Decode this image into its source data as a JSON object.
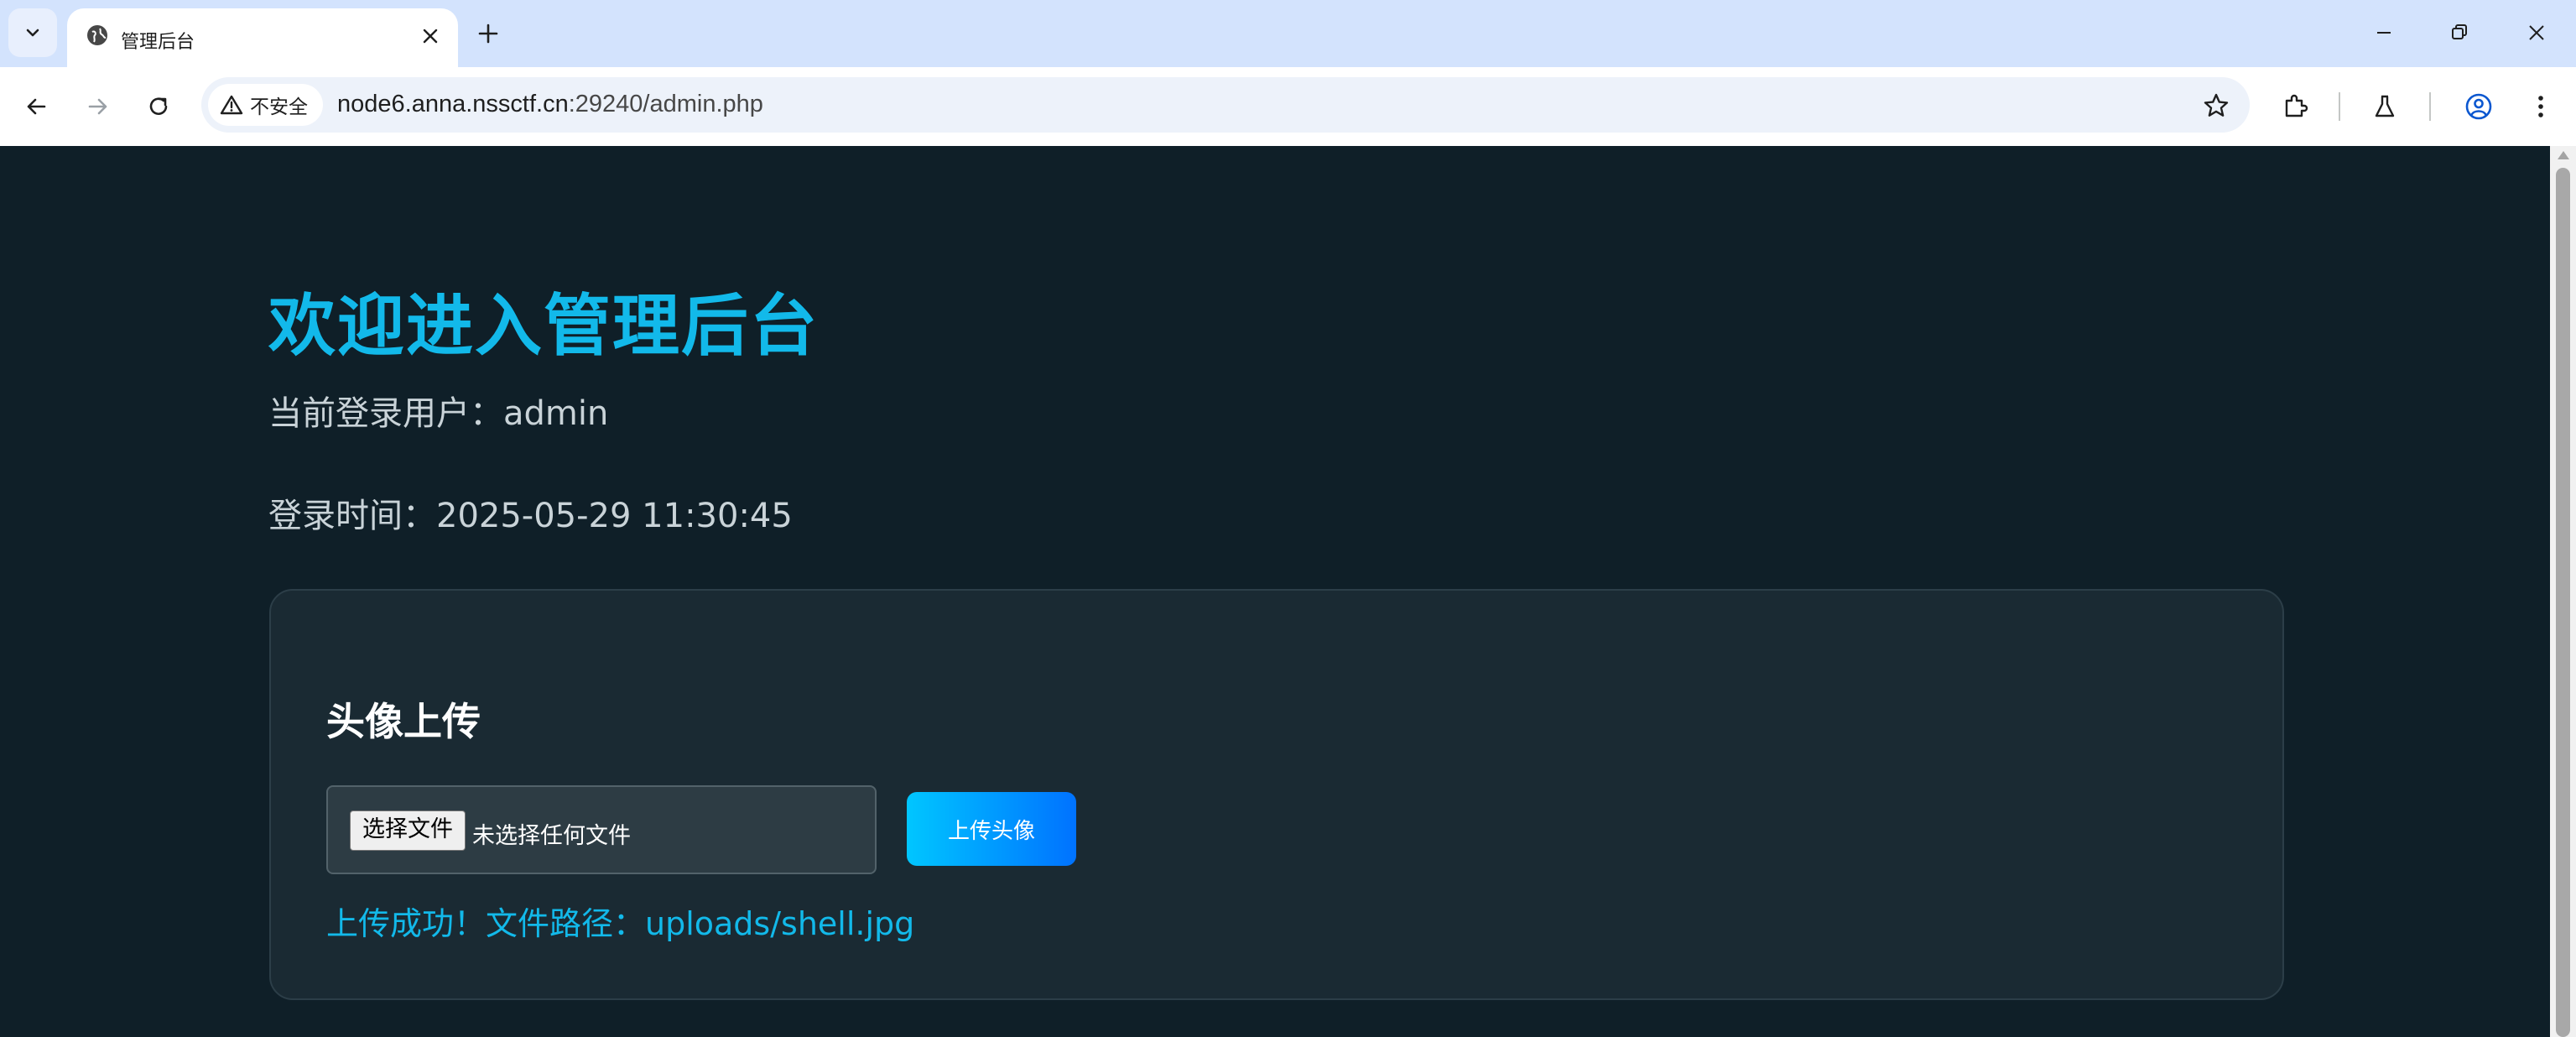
{
  "browser": {
    "tab_title": "管理后台",
    "security_label": "不安全",
    "url_host": "node6.anna.nssctf.cn",
    "url_rest": ":29240/admin.php"
  },
  "page": {
    "title": "欢迎进入管理后台",
    "user_line": "当前登录用户：admin",
    "time_line": "登录时间：2025-05-29 11:30:45",
    "upload_card": {
      "title": "头像上传",
      "file_button": "选择文件",
      "file_status": "未选择任何文件",
      "upload_button": "上传头像",
      "result": "上传成功！文件路径：uploads/shell.jpg"
    }
  },
  "colors": {
    "page_bg": "#0f1f28",
    "accent": "#12b9ea",
    "card_bg": "#1a2a33",
    "button_gradient_start": "#00c6ff",
    "button_gradient_end": "#0072ff"
  },
  "icons": {
    "tab_search": "chevron-down-icon",
    "favicon": "globe-icon",
    "tab_close": "close-icon",
    "new_tab": "plus-icon",
    "back": "arrow-left-icon",
    "forward": "arrow-right-icon",
    "reload": "reload-icon",
    "security": "warning-icon",
    "bookmark": "star-icon",
    "extensions": "puzzle-icon",
    "labs": "flask-icon",
    "profile": "account-icon",
    "menu": "kebab-menu-icon"
  }
}
